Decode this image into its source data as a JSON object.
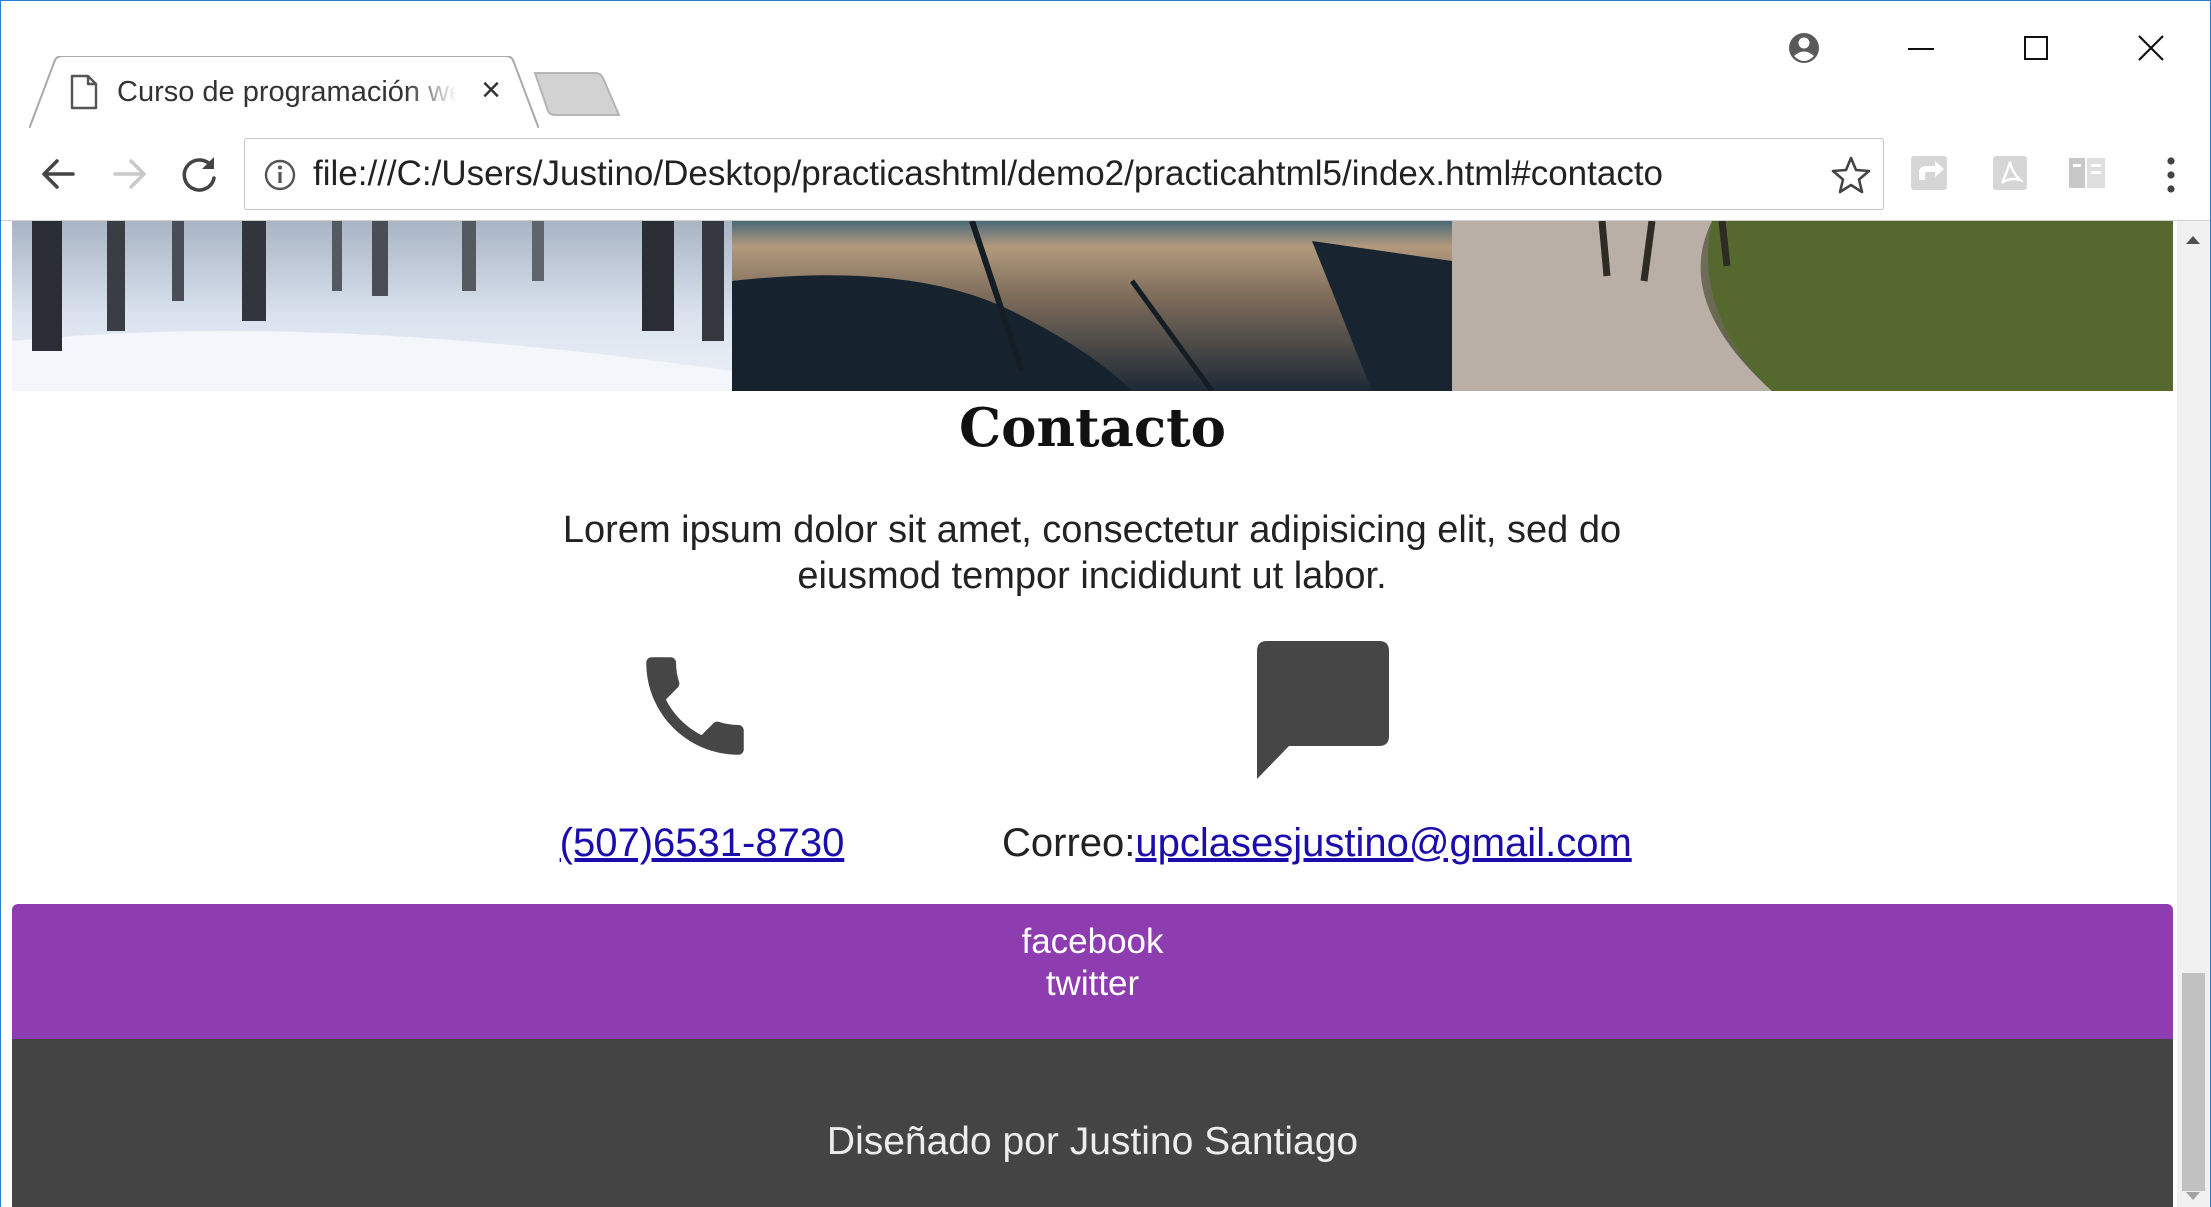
{
  "browser": {
    "tab_title": "Curso de programación web",
    "tab_close": "×",
    "url": "file:///C:/Users/Justino/Desktop/practicashtml/demo2/practicahtml5/index.html#contacto",
    "icons": {
      "profile": "account-circle-icon",
      "minimize": "minimize-icon",
      "maximize": "maximize-icon",
      "close": "close-icon",
      "back": "back-arrow-icon",
      "forward": "forward-arrow-icon",
      "reload": "reload-icon",
      "info": "info-icon",
      "bookmark": "star-icon",
      "menu": "more-vert-icon"
    }
  },
  "page": {
    "banner_images": [
      "snowy-forest-image",
      "beach-at-dusk-image",
      "flooded-trail-image"
    ],
    "contact": {
      "title": "Contacto",
      "description": "Lorem ipsum dolor sit amet, consectetur adipisicing elit, sed do eiusmod tempor incididunt ut labor.",
      "phone": "(507)6531-8730",
      "email_label": "Correo:",
      "email": "upclasesjustino@gmail.com",
      "phone_icon": "phone-icon",
      "message_icon": "chat-bubble-icon"
    },
    "social": {
      "links": [
        "facebook",
        "twitter"
      ],
      "color": "#8e3db0"
    },
    "footer": {
      "text": "Diseñado por Justino Santiago",
      "color": "#444444"
    }
  }
}
